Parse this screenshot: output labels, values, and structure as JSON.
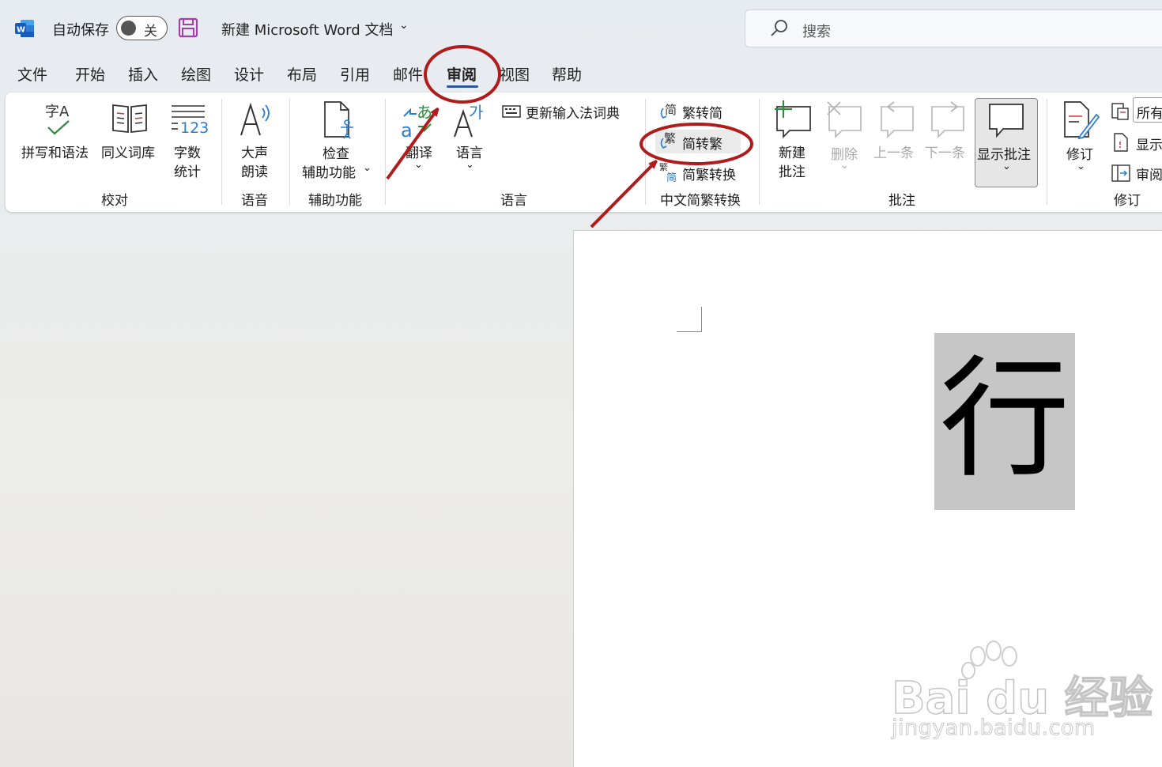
{
  "titlebar": {
    "autosave_label": "自动保存",
    "toggle_state": "关",
    "doc_title": "新建 Microsoft Word 文档",
    "search_placeholder": "搜索"
  },
  "tabs": [
    {
      "label": "文件"
    },
    {
      "label": "开始"
    },
    {
      "label": "插入"
    },
    {
      "label": "绘图"
    },
    {
      "label": "设计"
    },
    {
      "label": "布局"
    },
    {
      "label": "引用"
    },
    {
      "label": "邮件"
    },
    {
      "label": "审阅",
      "active": true
    },
    {
      "label": "视图"
    },
    {
      "label": "帮助"
    }
  ],
  "ribbon": {
    "proofing": {
      "spelling": "拼写和语法",
      "thesaurus": "同义词库",
      "wordcount_1": "字数",
      "wordcount_2": "统计",
      "group": "校对"
    },
    "speech": {
      "read_1": "大声",
      "read_2": "朗读",
      "group": "语音"
    },
    "accessibility": {
      "check_1": "检查",
      "check_2": "辅助功能",
      "group": "辅助功能"
    },
    "language": {
      "translate": "翻译",
      "language": "语言",
      "update_ime": "更新输入法词典",
      "group": "语言"
    },
    "chinese_conversion": {
      "trad_to_simp": "繁转简",
      "simp_to_trad": "简转繁",
      "conversion": "简繁转换",
      "group": "中文简繁转换"
    },
    "comments": {
      "new_1": "新建",
      "new_2": "批注",
      "delete": "删除",
      "previous": "上一条",
      "next": "下一条",
      "show": "显示批注",
      "group": "批注"
    },
    "tracking": {
      "track": "修订",
      "all_markup": "所有",
      "show_markup": "显示",
      "review_pane": "审阅",
      "group": "修订"
    }
  },
  "document": {
    "character": "行"
  },
  "watermark": {
    "brand": "Bai du 经验",
    "url": "jingyan.baidu.com"
  },
  "colors": {
    "accent": "#2b579a",
    "annotation": "#b01c1c",
    "selection": "#c6c6c6"
  }
}
